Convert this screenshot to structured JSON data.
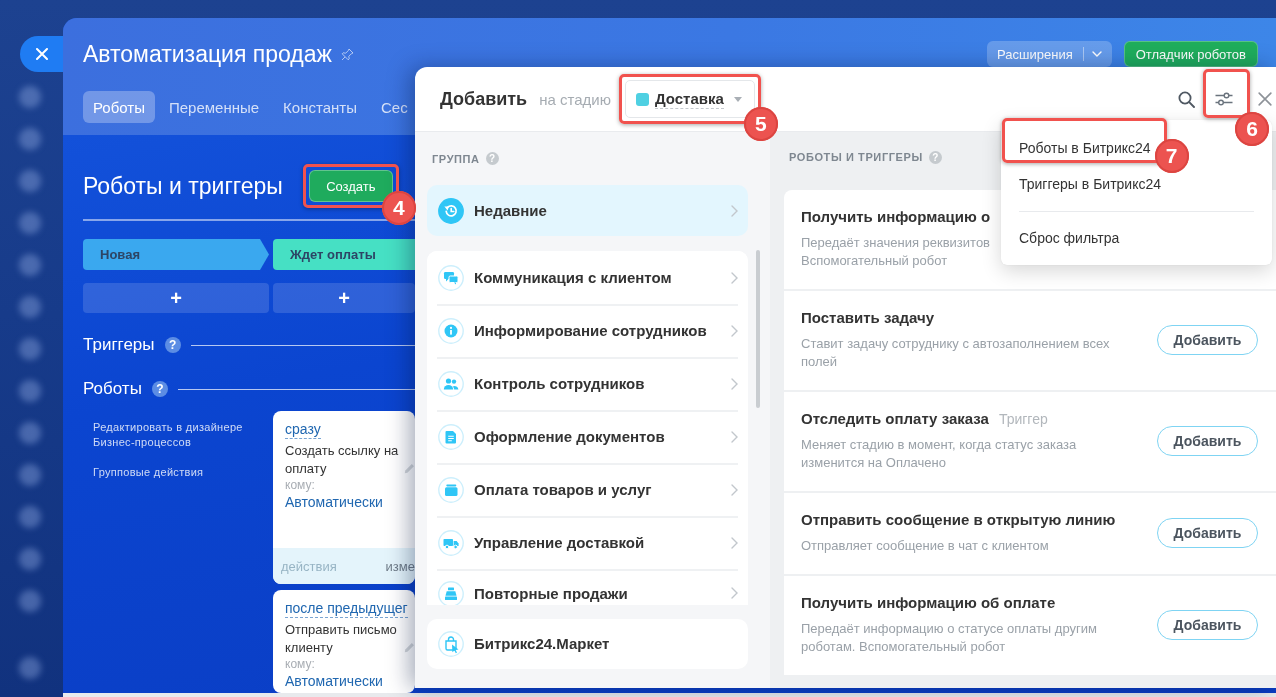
{
  "page": {
    "title": "Автоматизация продаж",
    "extensions_button": "Расширения",
    "debugger_button": "Отладчик роботов",
    "tabs": [
      {
        "label": "Роботы",
        "selected": true
      },
      {
        "label": "Переменные",
        "selected": false
      },
      {
        "label": "Константы",
        "selected": false
      },
      {
        "label": "Сес",
        "selected": false
      }
    ]
  },
  "robots_section": {
    "heading": "Роботы и триггеры",
    "create_button": {
      "label": "Создать",
      "callout": "4"
    },
    "stages": [
      {
        "label": "Новая",
        "color": "#3aa8ef",
        "add_button": "+"
      },
      {
        "label": "Ждет оплаты",
        "color": "#46e0c4",
        "add_button": "+"
      }
    ],
    "sections": [
      {
        "label": "Триггеры",
        "help": "?"
      },
      {
        "label": "Роботы",
        "help": "?"
      }
    ],
    "links": [
      "Редактировать в дизайнере Бизнес-процессов",
      "Групповые действия"
    ],
    "robot_cards": [
      {
        "delay": "сразу",
        "title": "Создать ссылку на оплату",
        "recipient_label": "кому:",
        "recipient": "Автоматически",
        "actions_link": "действия",
        "edit_link": "изме"
      },
      {
        "delay": "после предыдущег",
        "title": "Отправить письмо клиенту",
        "recipient_label": "кому:",
        "recipient": "Автоматически"
      }
    ]
  },
  "add_panel": {
    "title": "Добавить",
    "stage_prefix": "на стадию",
    "stage": {
      "label": "Доставка",
      "color": "#4fd0e2",
      "callout": "5"
    },
    "filter_button": {
      "callout": "6"
    },
    "groups_heading": {
      "label": "ГРУППА",
      "help": "?"
    },
    "groups": [
      {
        "kind": "recent",
        "label": "Недавние",
        "selected": true
      },
      {
        "kind": "category",
        "label": "Коммуникация с клиентом",
        "selected": false
      },
      {
        "kind": "category",
        "label": "Информирование сотрудников",
        "selected": false
      },
      {
        "kind": "category",
        "label": "Контроль сотрудников",
        "selected": false
      },
      {
        "kind": "category",
        "label": "Оформление документов",
        "selected": false
      },
      {
        "kind": "category",
        "label": "Оплата товаров и услуг",
        "selected": false
      },
      {
        "kind": "category",
        "label": "Управление доставкой",
        "selected": false
      },
      {
        "kind": "category",
        "label": "Повторные продажи",
        "selected": false
      },
      {
        "kind": "market",
        "label": "Битрикс24.Маркет",
        "selected": false
      }
    ],
    "robots_heading": {
      "label": "РОБОТЫ И ТРИГГЕРЫ",
      "help": "?"
    },
    "robots": [
      {
        "title": "Получить информацию о",
        "description": "Передаёт значения реквизитов\nВспомогательный робот"
      },
      {
        "title": "Поставить задачу",
        "description": "Ставит задачу сотруднику с автозаполнением всех полей",
        "button": "Добавить"
      },
      {
        "title": "Отследить оплату заказа",
        "tag": "Триггер",
        "description": "Меняет стадию в момент, когда статус заказа изменится на Оплачено",
        "button": "Добавить"
      },
      {
        "title": "Отправить сообщение в открытую линию",
        "description": "Отправляет сообщение в чат с клиентом",
        "button": "Добавить"
      },
      {
        "title": "Получить информацию об оплате",
        "description": "Передаёт информацию о статусе оплаты другим роботам. Вспомогательный робот",
        "button": "Добавить"
      }
    ],
    "filter_menu": {
      "items": [
        {
          "label": "Роботы в Битрикс24",
          "callout": "7"
        },
        {
          "label": "Триггеры в Битрикс24"
        }
      ],
      "reset": "Сброс фильтра"
    }
  }
}
